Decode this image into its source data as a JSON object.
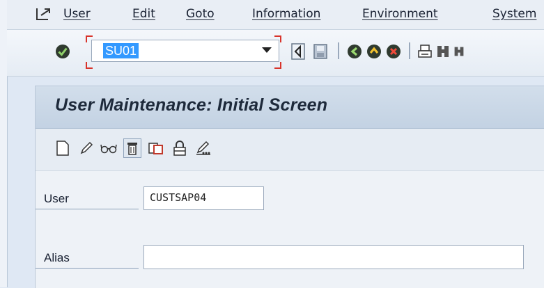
{
  "menu": {
    "items": [
      "User",
      "Edit",
      "Goto",
      "Information",
      "Environment",
      "System"
    ]
  },
  "toolbar": {
    "command_field_value": "SU01"
  },
  "page": {
    "title": "User Maintenance: Initial Screen"
  },
  "form": {
    "user_label": "User",
    "user_value": "CUSTSAP04",
    "alias_label": "Alias",
    "alias_value": ""
  },
  "colors": {
    "selection": "#3399ff",
    "focus_frame": "#d8342b",
    "ok_green": "#2d8a2d"
  }
}
